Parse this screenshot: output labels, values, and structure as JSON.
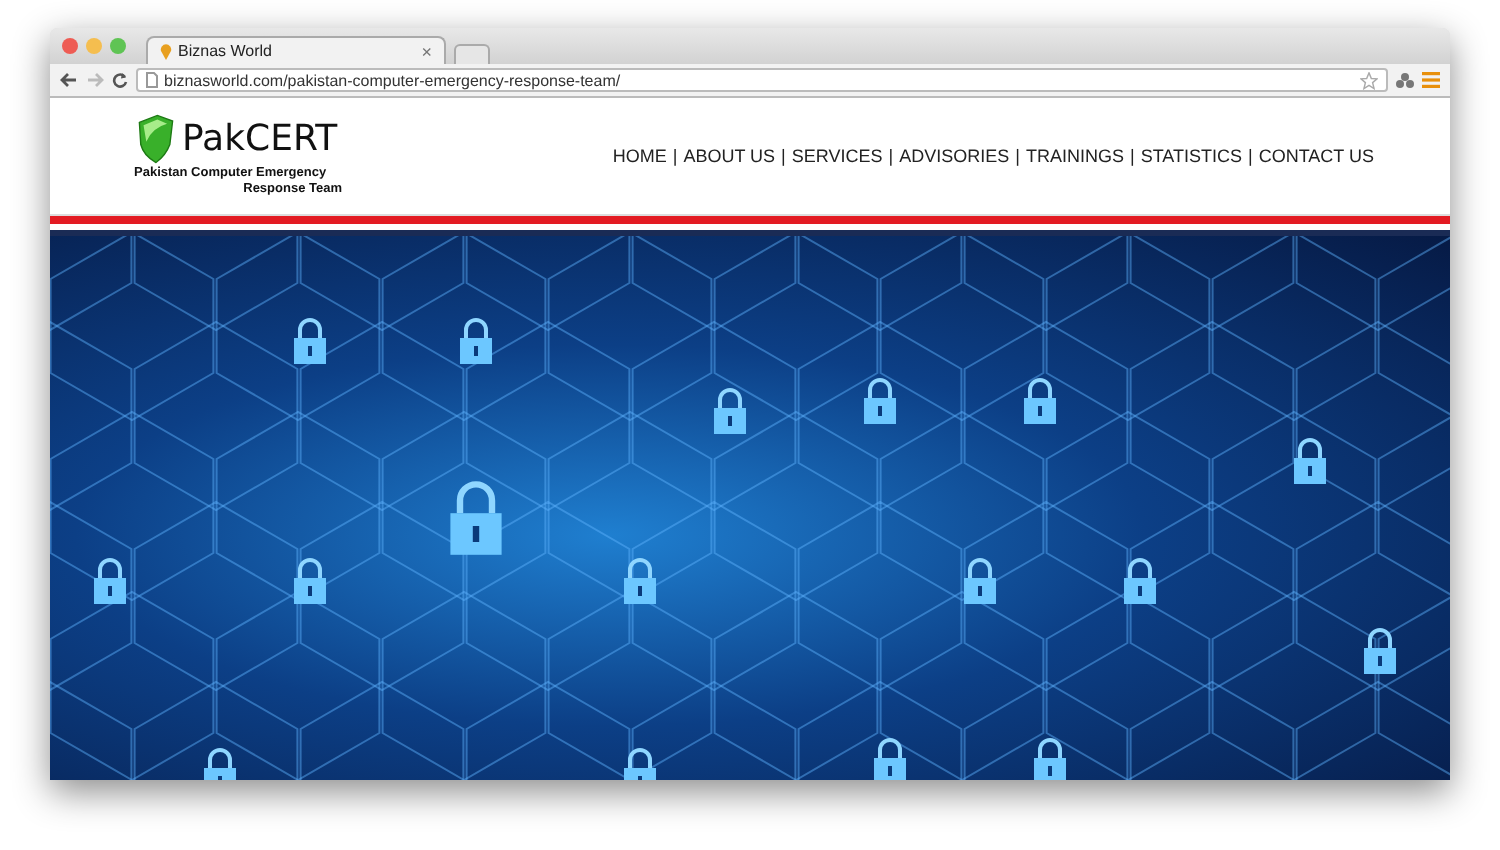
{
  "browser": {
    "tab_title": "Biznas World",
    "tab_close": "×",
    "url": "biznasworld.com/pakistan-computer-emergency-response-team/"
  },
  "logo": {
    "name": "PakCERT",
    "subtitle_line_1": "Pakistan Computer Emergency",
    "subtitle_line_2": "Response Team"
  },
  "nav": {
    "separator": "|",
    "items": [
      "HOME",
      "ABOUT US",
      "SERVICES",
      "ADVISORIES",
      "TRAININGS",
      "STATISTICS",
      "CONTACT US"
    ]
  }
}
